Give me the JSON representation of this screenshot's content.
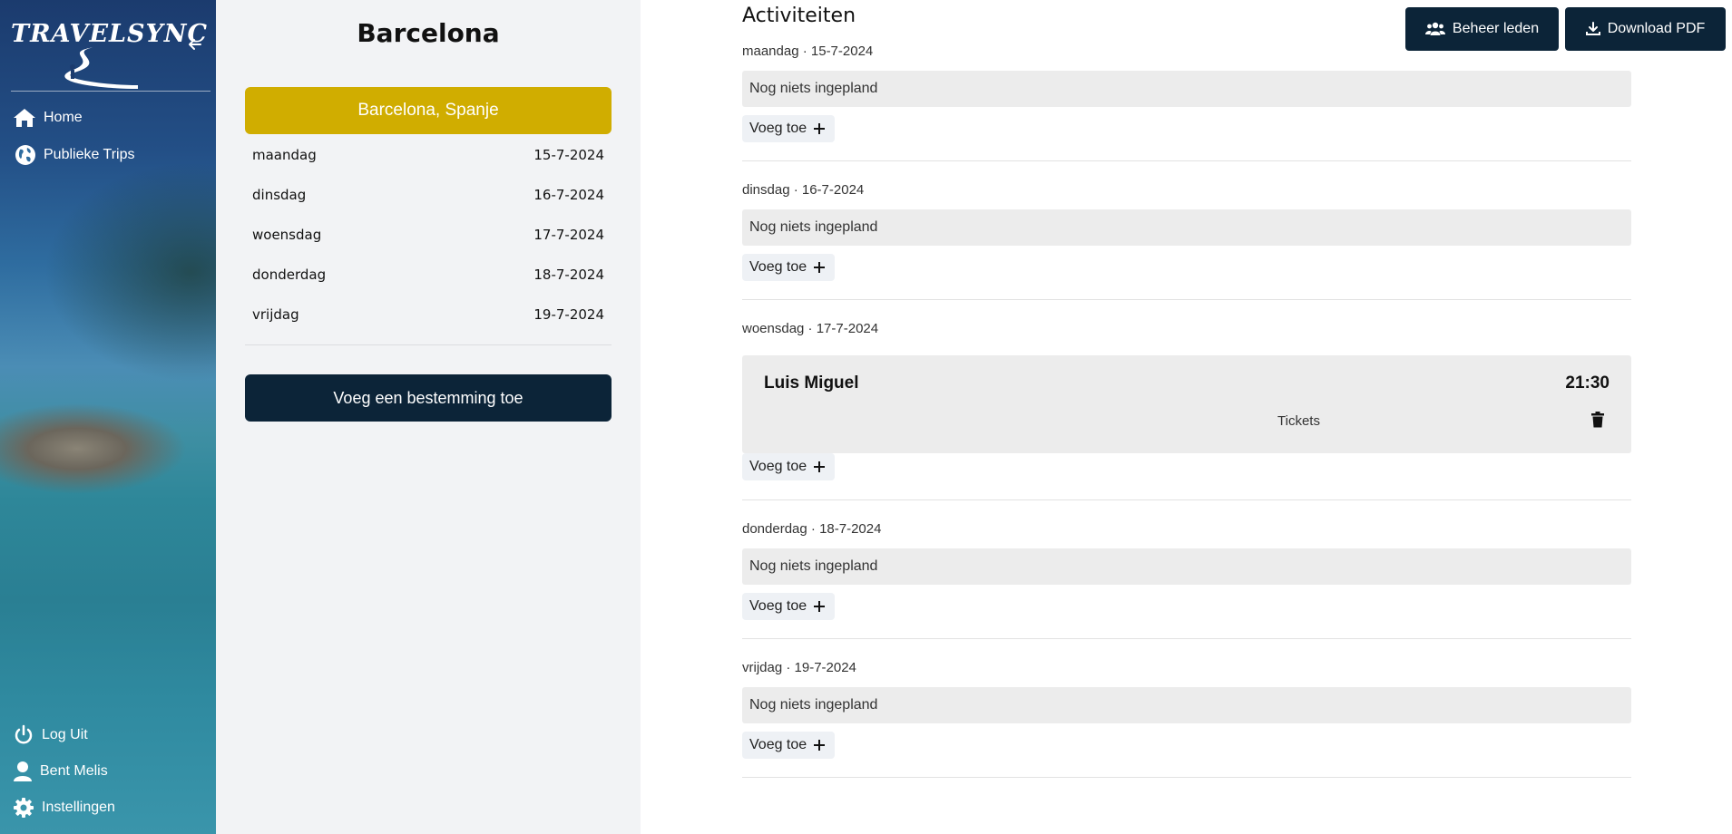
{
  "app": {
    "logo_text": "TRAVELSYNC"
  },
  "sidebar": {
    "nav": [
      {
        "label": "Home",
        "icon": "home-icon"
      },
      {
        "label": "Publieke Trips",
        "icon": "globe-icon"
      }
    ],
    "bottom": [
      {
        "label": "Log Uit",
        "icon": "power-icon"
      },
      {
        "label": "Bent Melis",
        "icon": "user-icon"
      },
      {
        "label": "Instellingen",
        "icon": "gear-icon"
      }
    ]
  },
  "trip": {
    "title": "Barcelona",
    "destination": "Barcelona, Spanje",
    "days": [
      {
        "day": "maandag",
        "date": "15-7-2024"
      },
      {
        "day": "dinsdag",
        "date": "16-7-2024"
      },
      {
        "day": "woensdag",
        "date": "17-7-2024"
      },
      {
        "day": "donderdag",
        "date": "18-7-2024"
      },
      {
        "day": "vrijdag",
        "date": "19-7-2024"
      }
    ],
    "add_destination_label": "Voeg een bestemming toe"
  },
  "main": {
    "title": "Activiteiten",
    "manage_members_label": "Beheer leden",
    "download_pdf_label": "Download PDF",
    "empty_text": "Nog niets ingepland",
    "add_label": "Voeg toe",
    "sections": [
      {
        "header": "maandag · 15-7-2024"
      },
      {
        "header": "dinsdag · 16-7-2024"
      },
      {
        "header": "woensdag · 17-7-2024",
        "activity": {
          "name": "Luis Miguel",
          "time": "21:30",
          "link": "Tickets"
        }
      },
      {
        "header": "donderdag · 18-7-2024"
      },
      {
        "header": "vrijdag · 19-7-2024"
      }
    ]
  },
  "colors": {
    "accent_yellow": "#d0ad00",
    "navy": "#0c2438"
  }
}
